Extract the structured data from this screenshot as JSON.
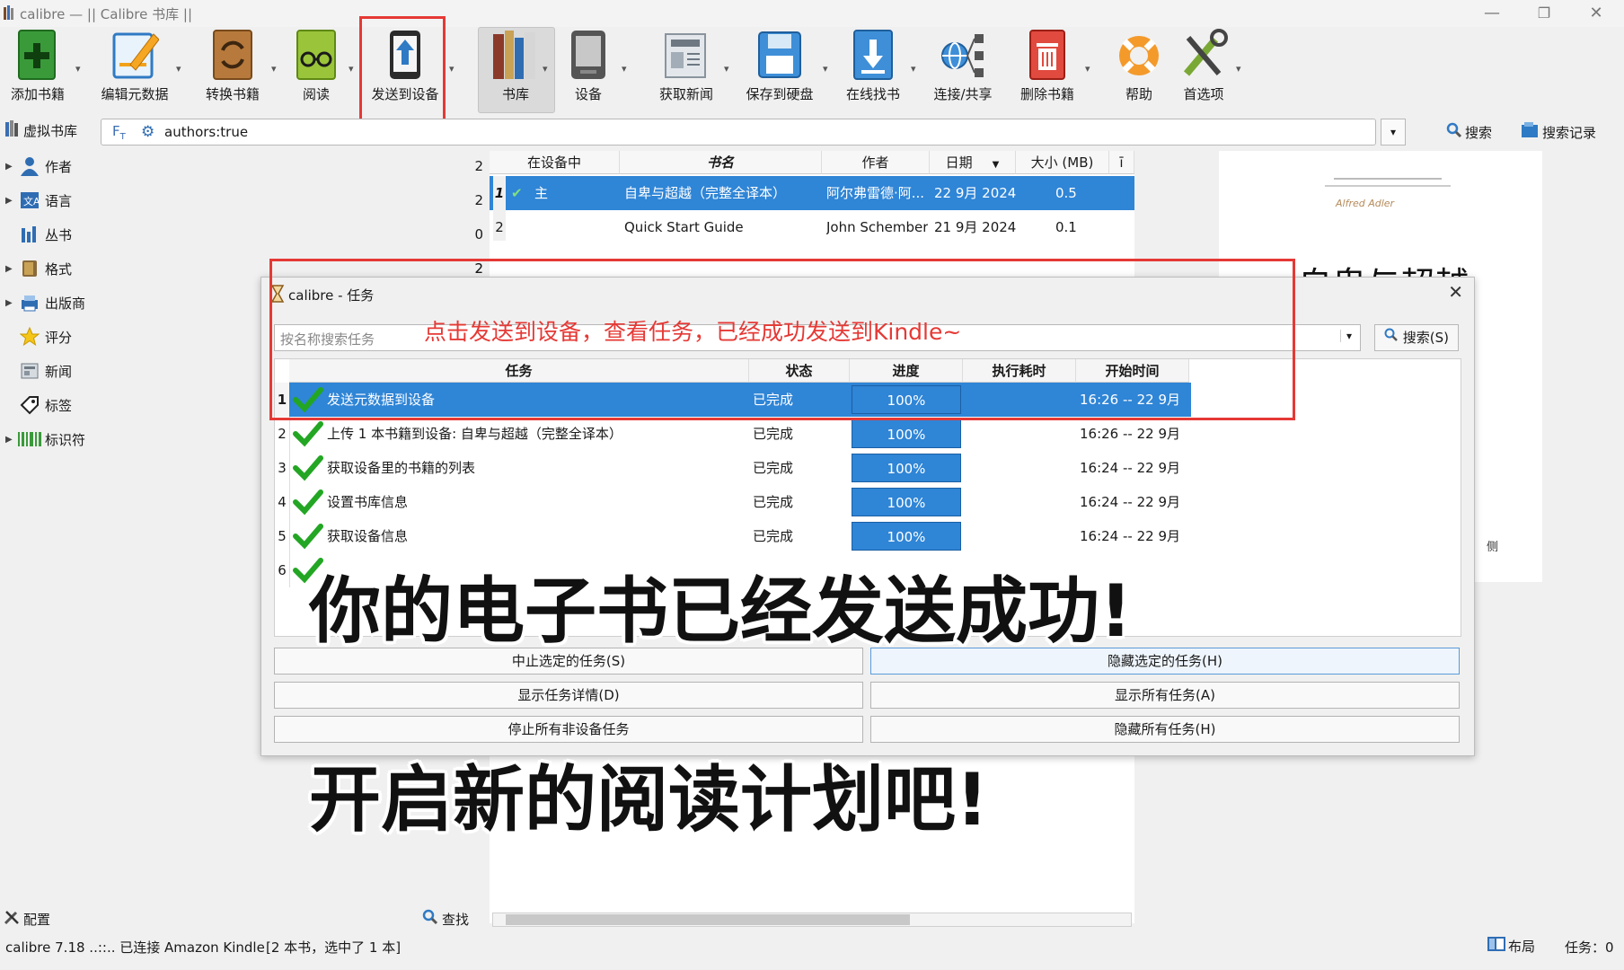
{
  "window": {
    "title": "calibre — || Calibre 书库 ||",
    "minimize": "—",
    "restore": "❐",
    "close": "✕"
  },
  "toolbar": {
    "add_books": "添加书籍",
    "edit_metadata": "编辑元数据",
    "convert": "转换书籍",
    "view": "阅读",
    "send_to_device": "发送到设备",
    "library": "书库",
    "device": "设备",
    "fetch_news": "获取新闻",
    "save_to_disk": "保存到硬盘",
    "get_books": "在线找书",
    "connect_share": "连接/共享",
    "remove_books": "删除书籍",
    "help": "帮助",
    "preferences": "首选项"
  },
  "searchbar": {
    "virtual_library": "虚拟书库",
    "query": "authors:true",
    "search_label": "搜索",
    "saved_searches": "搜索记录"
  },
  "sidebar": {
    "items": [
      {
        "label": "作者",
        "count": "2"
      },
      {
        "label": "语言",
        "count": "2"
      },
      {
        "label": "丛书",
        "count": "0"
      },
      {
        "label": "格式",
        "count": "2"
      },
      {
        "label": "出版商",
        "count": ""
      },
      {
        "label": "评分",
        "count": ""
      },
      {
        "label": "新闻",
        "count": ""
      },
      {
        "label": "标签",
        "count": ""
      },
      {
        "label": "标识符",
        "count": ""
      }
    ],
    "configure": "配置",
    "find": "查找"
  },
  "books": {
    "headers": [
      "在设备中",
      "书名",
      "作者",
      "日期",
      "大小 (MB)"
    ],
    "rows": [
      {
        "num": "1",
        "on_device": "主",
        "title": "自卑与超越（完整全译本）",
        "author": "阿尔弗雷德·阿...",
        "date": "22 9月 2024",
        "size": "0.5"
      },
      {
        "num": "2",
        "on_device": "",
        "title": "Quick Start Guide",
        "author": "John Schember",
        "date": "21 9月 2024",
        "size": "0.1"
      }
    ]
  },
  "preview": {
    "cover_title": "自卑与超越",
    "cover_author": "Alfred Adler"
  },
  "jobs": {
    "title": "calibre - 任务",
    "search_placeholder": "按名称搜索任务",
    "search_button": "搜索(S)",
    "headers": [
      "任务",
      "状态",
      "进度",
      "执行耗时",
      "开始时间"
    ],
    "rows": [
      {
        "num": "1",
        "task": "发送元数据到设备",
        "status": "已完成",
        "progress": "100%",
        "duration": "",
        "start": "16:26 -- 22 9月"
      },
      {
        "num": "2",
        "task": "上传 1 本书籍到设备: 自卑与超越（完整全译本）",
        "status": "已完成",
        "progress": "100%",
        "duration": "",
        "start": "16:26 -- 22 9月"
      },
      {
        "num": "3",
        "task": "获取设备里的书籍的列表",
        "status": "已完成",
        "progress": "100%",
        "duration": "",
        "start": "16:24 -- 22 9月"
      },
      {
        "num": "4",
        "task": "设置书库信息",
        "status": "已完成",
        "progress": "100%",
        "duration": "",
        "start": "16:24 -- 22 9月"
      },
      {
        "num": "5",
        "task": "获取设备信息",
        "status": "已完成",
        "progress": "100%",
        "duration": "",
        "start": "16:24 -- 22 9月"
      },
      {
        "num": "6",
        "task": "",
        "status": "",
        "progress": "",
        "duration": "",
        "start": ""
      }
    ],
    "buttons": {
      "abort_selected": "中止选定的任务(S)",
      "hide_selected": "隐藏选定的任务(H)",
      "show_details": "显示任务详情(D)",
      "show_all": "显示所有任务(A)",
      "stop_non_device": "停止所有非设备任务",
      "hide_all": "隐藏所有任务(H)"
    }
  },
  "annotation": "点击发送到设备，查看任务，已经成功发送到Kindle~",
  "captions": {
    "line1": "你的电子书已经发送成功!",
    "line2": "开启新的阅读计划吧!"
  },
  "status": {
    "left": "calibre 7.18 ..::.. 已连接 Amazon Kindle",
    "count": "[2 本书，选中了 1 本]",
    "layout": "布局",
    "jobs": "任务：0"
  },
  "colors": {
    "accent": "#2f85d6",
    "highlight_red": "#e53935",
    "annotation_red": "#e53935"
  }
}
